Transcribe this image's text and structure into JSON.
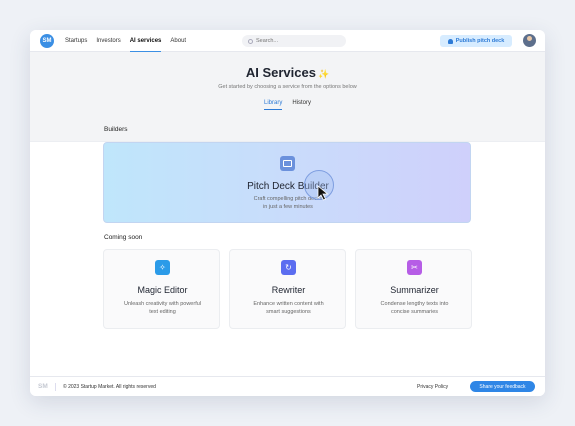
{
  "header": {
    "logo_text": "SM",
    "nav": [
      "Startups",
      "Investors",
      "AI services",
      "About"
    ],
    "active_nav": "AI services",
    "search_placeholder": "Search...",
    "publish_label": "Publish pitch deck"
  },
  "hero": {
    "title": "AI Services",
    "sparkle": "✨",
    "subtitle": "Get started by choosing a service from the options below",
    "tabs": [
      "Library",
      "History"
    ],
    "active_tab": "Library"
  },
  "builders": {
    "label": "Builders",
    "card": {
      "icon": "presentation-icon",
      "title": "Pitch Deck Builder",
      "desc_line1": "Craft compelling pitch decks",
      "desc_line2": "in just a few minutes"
    }
  },
  "coming_soon": {
    "label": "Coming soon",
    "cards": [
      {
        "icon": "magic-wand-icon",
        "icon_color": "#2b9be8",
        "title": "Magic Editor",
        "desc_line1": "Unleash creativity with powerful",
        "desc_line2": "text editing"
      },
      {
        "icon": "refresh-icon",
        "icon_color": "#5b6df0",
        "title": "Rewriter",
        "desc_line1": "Enhance written content with",
        "desc_line2": "smart suggestions"
      },
      {
        "icon": "scissors-icon",
        "icon_color": "#b65de6",
        "title": "Summarizer",
        "desc_line1": "Condense lengthy texts into",
        "desc_line2": "concise summaries"
      }
    ]
  },
  "footer": {
    "logo_text": "SM",
    "copyright": "© 2023 Startup Market. All rights reserved",
    "privacy": "Privacy Policy",
    "feedback": "Share your feedback"
  },
  "colors": {
    "accent": "#2f86e6",
    "primary_blue": "#3b8fe4"
  }
}
